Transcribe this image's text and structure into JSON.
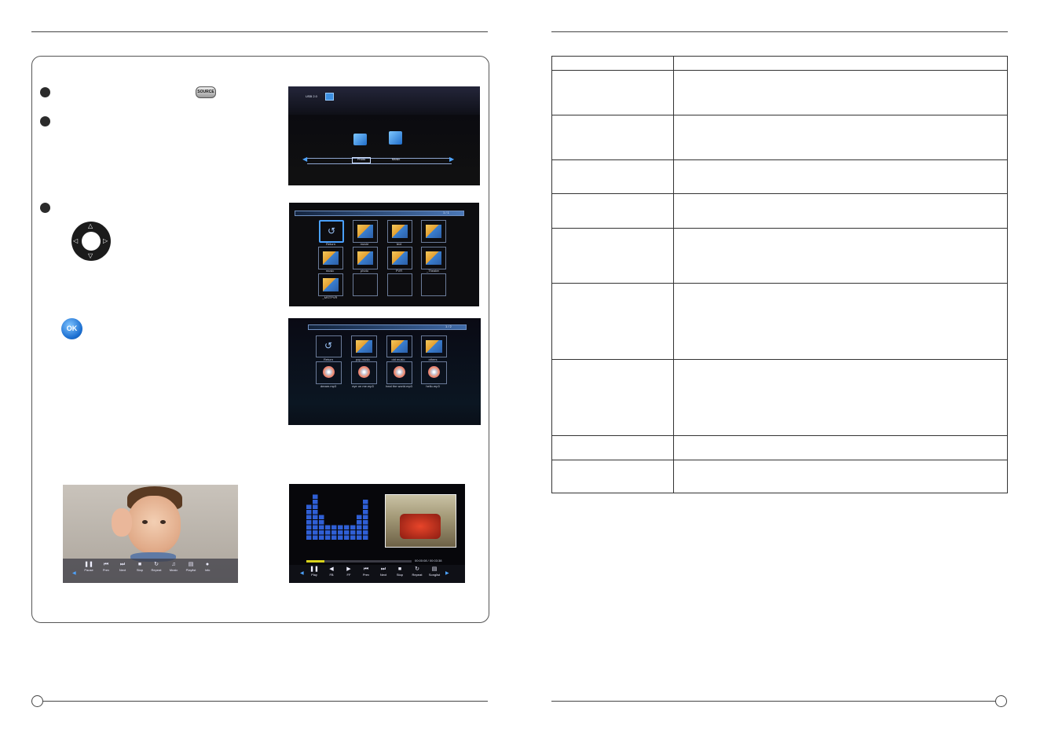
{
  "remote": {
    "source_button_label": "SOURCE",
    "ok_button_label": "OK"
  },
  "screens": {
    "usb_menu": {
      "header_label": "USB 2.0",
      "options": [
        "Photo",
        "Music"
      ]
    },
    "folder_browser": {
      "page_indicator": "1 / 1",
      "items": [
        "Return",
        "movie",
        "text",
        "",
        "music",
        "photo",
        "PVR",
        "_Theater",
        "_MSTPVR"
      ]
    },
    "music_browser": {
      "page_indicator": "1 / 2",
      "items": [
        "Return",
        "pop music",
        "old music",
        "others",
        "dream.mp3",
        "eye on me.mp3",
        "heal the world.mp3",
        "hello.mp3"
      ]
    },
    "photo_player": {
      "controls": [
        "Pause",
        "Prev",
        "Next",
        "Stop",
        "Repeat",
        "Music",
        "Playlist",
        "Info"
      ]
    },
    "music_player": {
      "time_display": "00:00:08 / 00:03:38",
      "progress_fraction": 0.17,
      "controls": [
        "Play",
        "FB",
        "FF",
        "Prev",
        "Next",
        "Stop",
        "Repeat",
        "Songlist"
      ]
    }
  },
  "colors": {
    "accent_blue": "#1c6fd1",
    "progress_yellow": "#d8d21c",
    "equalizer_blue": "#2f5fd6"
  },
  "spec_table": {
    "row_heights": [
      18,
      57,
      57,
      43,
      44,
      70,
      97,
      97,
      31,
      42
    ]
  }
}
